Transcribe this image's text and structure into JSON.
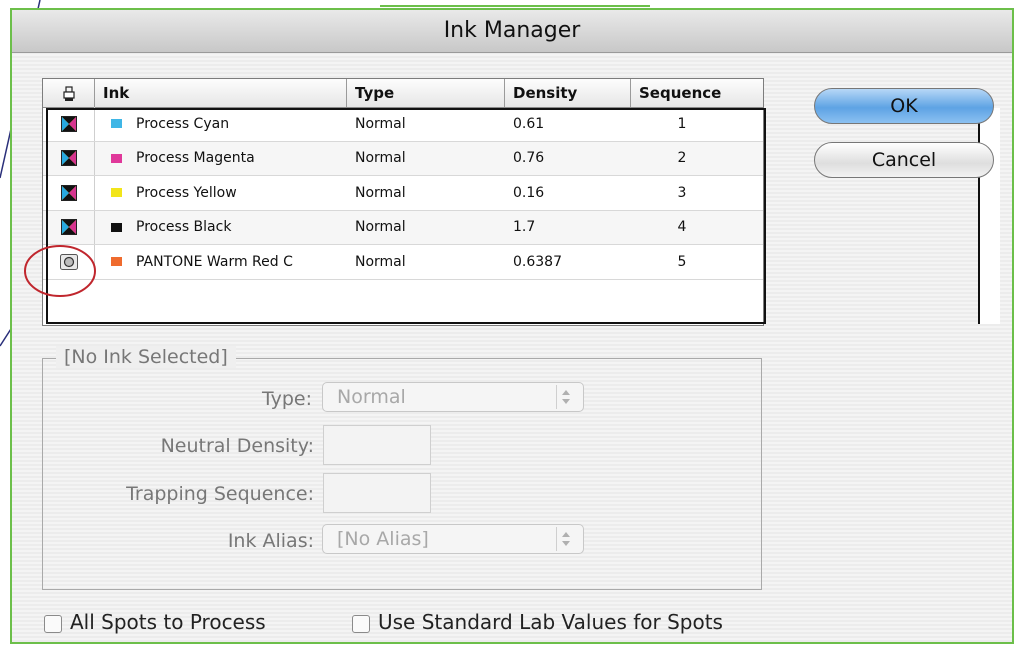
{
  "window": {
    "title": "Ink Manager"
  },
  "table": {
    "headers": [
      "",
      "Ink",
      "Type",
      "Density",
      "Sequence"
    ],
    "rows": [
      {
        "icon": "process-ink-icon",
        "swatch": "#3fb6e6",
        "ink": "Process Cyan",
        "type": "Normal",
        "density": "0.61",
        "sequence": "1"
      },
      {
        "icon": "process-ink-icon",
        "swatch": "#e0389a",
        "ink": "Process Magenta",
        "type": "Normal",
        "density": "0.76",
        "sequence": "2"
      },
      {
        "icon": "process-ink-icon",
        "swatch": "#f2e51a",
        "ink": "Process Yellow",
        "type": "Normal",
        "density": "0.16",
        "sequence": "3"
      },
      {
        "icon": "process-ink-icon",
        "swatch": "#111111",
        "ink": "Process Black",
        "type": "Normal",
        "density": "1.7",
        "sequence": "4"
      },
      {
        "icon": "spot-ink-icon",
        "swatch": "#ef6b2e",
        "ink": "PANTONE Warm Red C",
        "type": "Normal",
        "density": "0.6387",
        "sequence": "5"
      }
    ]
  },
  "buttons": {
    "ok": "OK",
    "cancel": "Cancel"
  },
  "details": {
    "title": "[No Ink Selected]",
    "type_label": "Type:",
    "type_value": "Normal",
    "neutral_density_label": "Neutral Density:",
    "trapping_sequence_label": "Trapping Sequence:",
    "ink_alias_label": "Ink Alias:",
    "ink_alias_value": "[No Alias]"
  },
  "options": {
    "all_spots": "All Spots to Process",
    "standard_lab": "Use Standard Lab Values for Spots"
  },
  "colors": {
    "accent": "#5ea3e4",
    "frame": "#6cbf4a",
    "annotation": "#c0262d",
    "pointer": "#2a2f7a"
  }
}
